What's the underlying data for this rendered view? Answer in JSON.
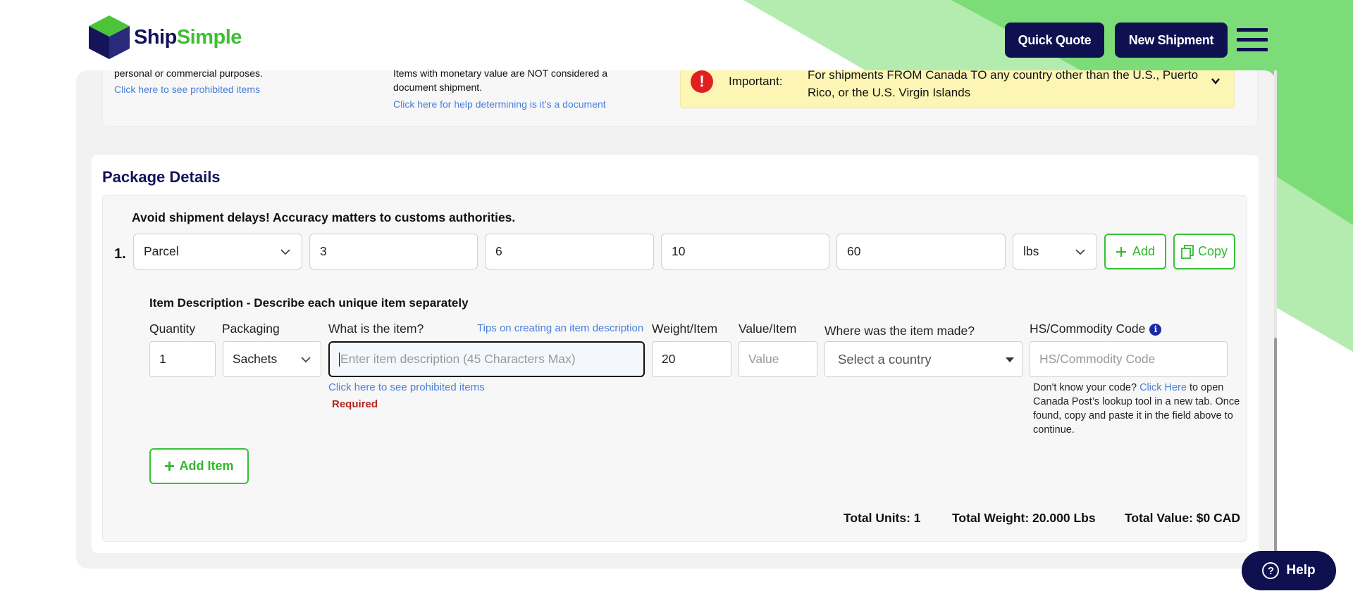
{
  "header": {
    "brand_ship": "Ship",
    "brand_simple": "Simple",
    "quick_quote": "Quick Quote",
    "new_shipment": "New Shipment"
  },
  "top_section": {
    "col1_text": "personal or commercial purposes.",
    "col1_link": "Click here to see prohibited items",
    "col2_text": "Items with monetary value are NOT considered a document shipment.",
    "col2_link": "Click here for help determining is it’s a document",
    "alert_label": "Important:",
    "alert_text": "For shipments FROM Canada TO any country other than the U.S., Puerto Rico, or the U.S. Virgin Islands"
  },
  "package": {
    "title": "Package Details",
    "warning": "Avoid shipment delays! Accuracy matters to customs authorities.",
    "row_number": "1.",
    "type": "Parcel",
    "length": "3",
    "width": "6",
    "height": "10",
    "weight": "60",
    "unit": "lbs",
    "add_label": "Add",
    "copy_label": "Copy"
  },
  "item": {
    "section_title": "Item Description - Describe each unique item separately",
    "quantity_label": "Quantity",
    "packaging_label": "Packaging",
    "what_label": "What is the item?",
    "tips_link": "Tips on creating an item description",
    "weight_label": "Weight/Item",
    "value_label": "Value/Item",
    "made_label": "Where was the item made?",
    "hs_label": "HS/Commodity Code",
    "quantity_value": "1",
    "packaging_value": "Sachets",
    "description_placeholder": "Enter item description (45 Characters Max)",
    "weight_value": "20",
    "value_placeholder": "Value",
    "country_placeholder": "Select a country",
    "hs_placeholder": "HS/Commodity Code",
    "prohibited_link": "Click here to see prohibited items",
    "required_text": "Required",
    "hs_help_prefix": "Don't know your code?",
    "hs_help_link": "Click Here",
    "hs_help_suffix": "to open Canada Post’s lookup tool in a new tab. Once found, copy and paste it in the field above to continue.",
    "add_item_label": "Add Item"
  },
  "totals": {
    "units": "Total Units: 1",
    "weight": "Total Weight: 20.000 Lbs",
    "value": "Total Value: $0 CAD"
  },
  "help": {
    "label": "Help"
  },
  "colors": {
    "navy": "#0f1050",
    "green": "#36c236",
    "link": "#4a7fd6",
    "alert_bg": "#fdf5b3",
    "error": "#b3261e"
  },
  "icons": [
    "logo-cube-icon",
    "menu-icon",
    "alert-icon",
    "chevron-down-icon",
    "plus-icon",
    "copy-icon",
    "info-icon",
    "help-icon"
  ]
}
